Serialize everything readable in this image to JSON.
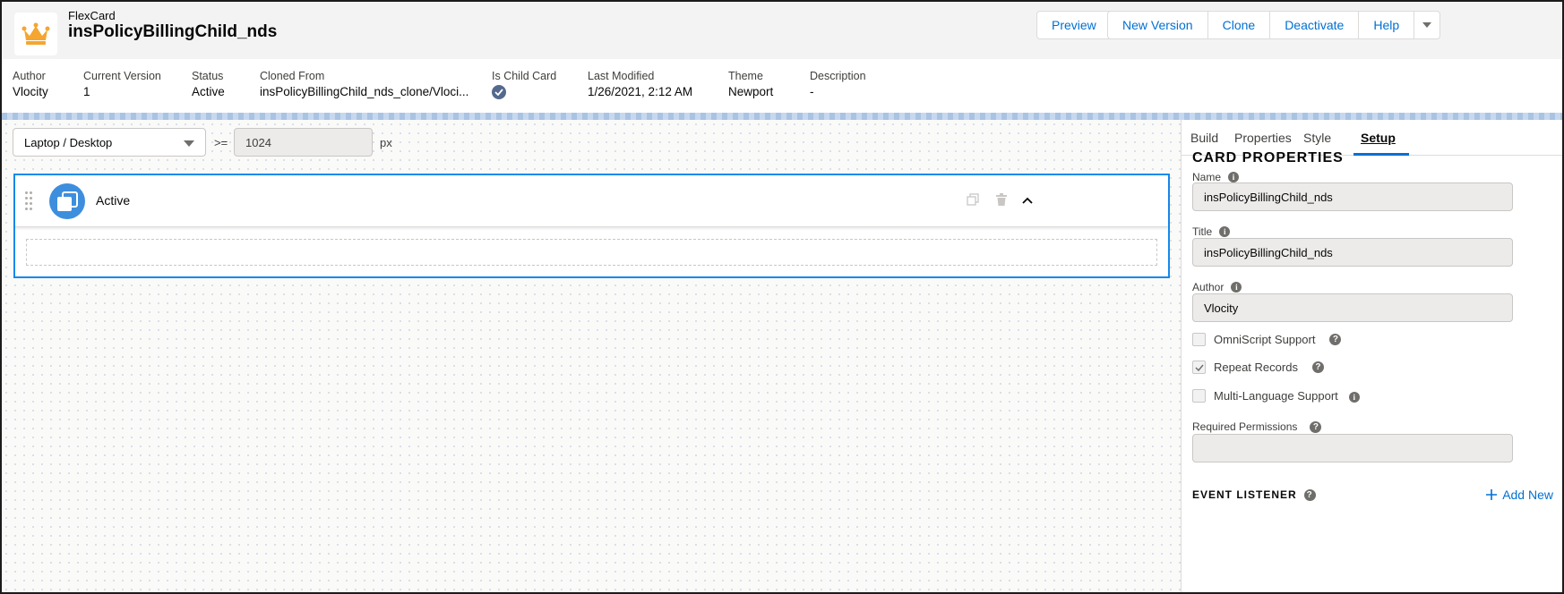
{
  "header": {
    "object_type": "FlexCard",
    "title": "insPolicyBillingChild_nds",
    "logo_icon": "crown-icon",
    "buttons": {
      "preview": "Preview",
      "new_version": "New Version",
      "clone": "Clone",
      "deactivate": "Deactivate",
      "help": "Help"
    }
  },
  "highlights": {
    "author_label": "Author",
    "author": "Vlocity",
    "version_label": "Current Version",
    "version": "1",
    "status_label": "Status",
    "status": "Active",
    "cloned_label": "Cloned From",
    "cloned": "insPolicyBillingChild_nds_clone/Vloci...",
    "child_label": "Is Child Card",
    "child_checked": true,
    "modified_label": "Last Modified",
    "modified": "1/26/2021, 2:12 AM",
    "theme_label": "Theme",
    "theme": "Newport",
    "desc_label": "Description",
    "desc": "-"
  },
  "canvas": {
    "device": "Laptop / Desktop",
    "operator": ">=",
    "breakpoint": "1024",
    "unit": "px",
    "state_name": "Active"
  },
  "panel": {
    "tabs": [
      "Build",
      "Properties",
      "Style",
      "Setup"
    ],
    "active_tab": "Setup",
    "section_title": "CARD PROPERTIES",
    "name_label": "Name",
    "name_value": "insPolicyBillingChild_nds",
    "title_label": "Title",
    "title_value": "insPolicyBillingChild_nds",
    "author_label": "Author",
    "author_value": "Vlocity",
    "checkboxes": [
      {
        "label": "OmniScript Support",
        "checked": false
      },
      {
        "label": "Repeat Records",
        "checked": true
      },
      {
        "label": "Multi-Language Support",
        "checked": false
      }
    ],
    "permissions_label": "Required Permissions",
    "permissions_value": "",
    "event_listener_label": "EVENT LISTENER",
    "add_new": "Add New"
  },
  "colors": {
    "brand": "#0070d2",
    "state_border": "#1589ee",
    "crown": "#f4a630"
  }
}
